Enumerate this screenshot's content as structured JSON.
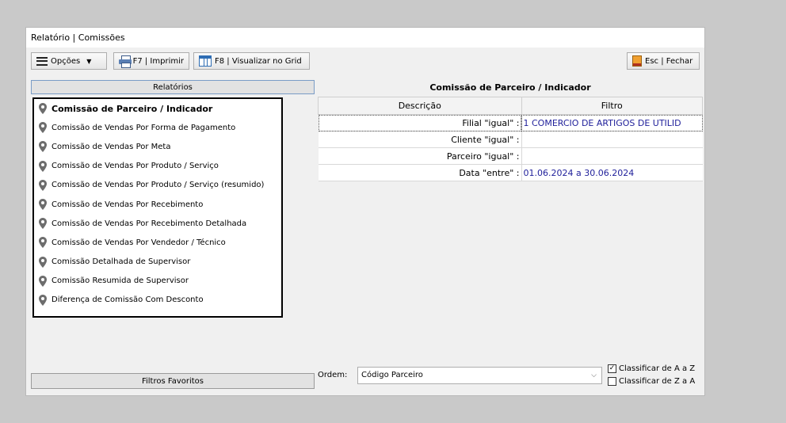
{
  "window": {
    "title": "Relatório | Comissões"
  },
  "toolbar": {
    "options_label": "Opções",
    "print_label": "F7 | Imprimir",
    "grid_label": "F8 | Visualizar no Grid",
    "close_label": "Esc | Fechar"
  },
  "left_panel": {
    "header": "Relatórios",
    "favorites": "Filtros Favoritos",
    "items": [
      "Comissão de Parceiro / Indicador",
      "Comissão de Vendas Por Forma de Pagamento",
      "Comissão de Vendas Por Meta",
      "Comissão de Vendas Por Produto / Serviço",
      "Comissão de Vendas Por Produto / Serviço (resumido)",
      "Comissão de Vendas Por Recebimento",
      "Comissão de Vendas Por Recebimento Detalhada",
      "Comissão de Vendas Por Vendedor / Técnico",
      "Comissão Detalhada de Supervisor",
      "Comissão Resumida de Supervisor",
      "Diferença de Comissão Com Desconto"
    ]
  },
  "right_panel": {
    "title": "Comissão de Parceiro / Indicador",
    "columns": {
      "desc": "Descrição",
      "filter": "Filtro"
    },
    "rows": [
      {
        "desc": "Filial \"igual\" :",
        "value": "1 COMERCIO DE ARTIGOS DE UTILID"
      },
      {
        "desc": "Cliente \"igual\" :",
        "value": ""
      },
      {
        "desc": "Parceiro \"igual\" :",
        "value": ""
      },
      {
        "desc": "Data \"entre\" :",
        "value": "01.06.2024 a 30.06.2024"
      }
    ],
    "order_label": "Ordem:",
    "order_value": "Código Parceiro",
    "sort_az": "Classificar de A a Z",
    "sort_za": "Classificar de Z a A",
    "sort_az_checked": true,
    "sort_za_checked": false
  }
}
